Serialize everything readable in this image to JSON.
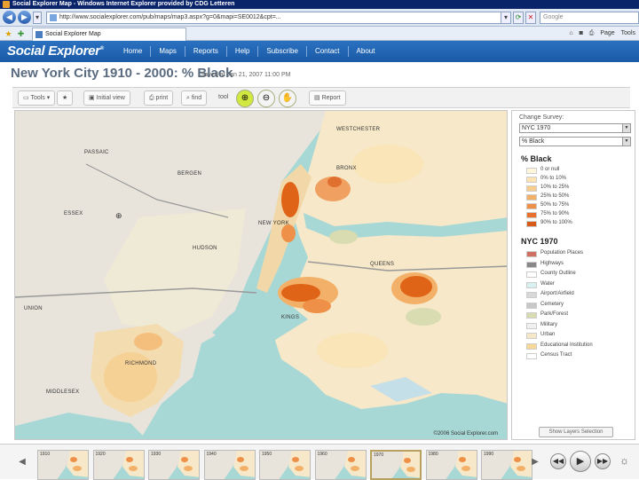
{
  "browser": {
    "title": "Social Explorer Map - Windows Internet Explorer provided by CDG Letteren",
    "url": "http://www.socialexplorer.com/pub/maps/map3.aspx?g=0&mapi=SE0012&cpt=...",
    "search_placeholder": "Google",
    "tab_label": "Social Explorer Map",
    "tools": [
      "Page",
      "Tools"
    ]
  },
  "app": {
    "logo": "Social Explorer",
    "nav": [
      "Home",
      "Maps",
      "Reports",
      "Help",
      "Subscribe",
      "Contact",
      "About"
    ]
  },
  "map": {
    "title": "New York City 1910 - 2000: % Black",
    "saved": "Saved at Jan 21, 2007 11:00 PM",
    "copyright": "©2006 Social Explorer.com",
    "labels": {
      "westchester": "WESTCHESTER",
      "bronx": "BRONX",
      "passaic": "PASSAIC",
      "bergen": "BERGEN",
      "essex": "ESSEX",
      "hudson": "HUDSON",
      "newyork": "NEW YORK",
      "queens": "QUEENS",
      "kings": "KINGS",
      "union": "UNION",
      "richmond": "RICHMOND",
      "middlesex": "MIDDLESEX"
    }
  },
  "toolbar": {
    "items": [
      "Tools",
      "Initial view",
      "print",
      "find",
      "tool",
      "Report"
    ]
  },
  "legend": {
    "change_label": "Change Survey:",
    "survey_value": "NYC 1970",
    "variable_value": "% Black",
    "heading": "% Black",
    "colors": [
      "#fff6dc",
      "#fbe3b4",
      "#f7cc8c",
      "#f3b068",
      "#ee9048",
      "#e8702c",
      "#d85a18"
    ],
    "classes": [
      "0 or null",
      "0% to 10%",
      "10% to 25%",
      "25% to 50%",
      "50% to 75%",
      "75% to 90%",
      "90% to 100%"
    ],
    "layer_heading": "NYC 1970",
    "layers": [
      "Population Places",
      "Highways",
      "County Outline",
      "Water",
      "Airport/Airfield",
      "Cemetery",
      "Park/Forest",
      "Military",
      "Urban",
      "Educational Institution",
      "Census Tract"
    ],
    "layer_colors": [
      "#d07060",
      "#888888",
      "#ffffff",
      "#d8f0f0",
      "#d8d8d8",
      "#c8c8c8",
      "#d8dcb0",
      "#f0f0f0",
      "#f4e8c8",
      "#f8d898",
      "#ffffff"
    ],
    "button": "Show Layers Selection"
  },
  "filmstrip": {
    "captions": [
      "1910",
      "1920",
      "1930",
      "1940",
      "1950",
      "1960",
      "1970",
      "1980",
      "1990"
    ]
  }
}
